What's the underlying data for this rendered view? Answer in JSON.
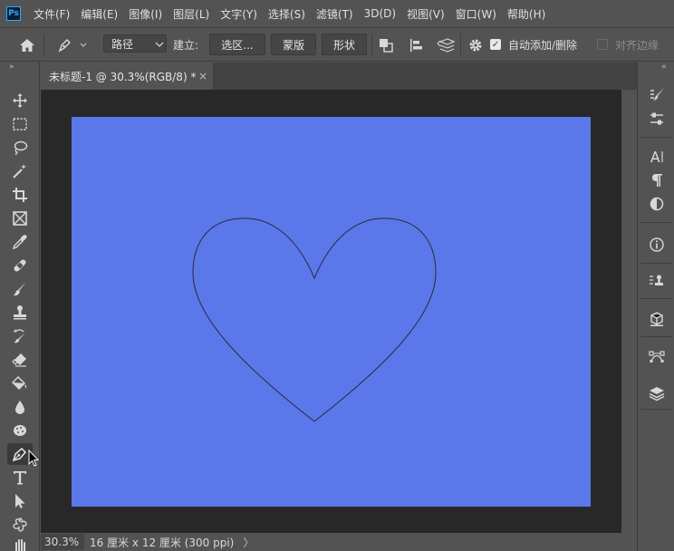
{
  "app": {
    "logo_text": "Ps"
  },
  "menu": [
    "文件(F)",
    "编辑(E)",
    "图像(I)",
    "图层(L)",
    "文字(Y)",
    "选择(S)",
    "滤镜(T)",
    "3D(D)",
    "视图(V)",
    "窗口(W)",
    "帮助(H)"
  ],
  "options": {
    "mode_select": "路径",
    "build_label": "建立:",
    "selection_button": "选区...",
    "mask_button": "蒙版",
    "shape_button": "形状",
    "auto_add_delete_label": "自动添加/删除",
    "auto_add_delete_checked": true,
    "align_edges_label": "对齐边缘",
    "align_edges_checked": false
  },
  "document": {
    "tab_title": "未标题-1 @ 30.3%(RGB/8) *",
    "canvas_color": "#5a78ea",
    "path_color": "#2a2a3a"
  },
  "status": {
    "zoom": "30.3%",
    "doc_info": "16 厘米 x 12 厘米 (300 ppi)",
    "arrow": "〉"
  },
  "tools": [
    "move-tool",
    "rectangular-marquee-tool",
    "lasso-tool",
    "magic-wand-tool",
    "crop-tool",
    "frame-tool",
    "eyedropper-tool",
    "spot-healing-tool",
    "brush-tool",
    "clone-stamp-tool",
    "history-brush-tool",
    "eraser-tool",
    "paint-bucket-tool",
    "blur-tool",
    "sponge-tool",
    "pen-tool",
    "type-tool",
    "path-selection-tool",
    "custom-shape-tool",
    "hand-tool"
  ]
}
